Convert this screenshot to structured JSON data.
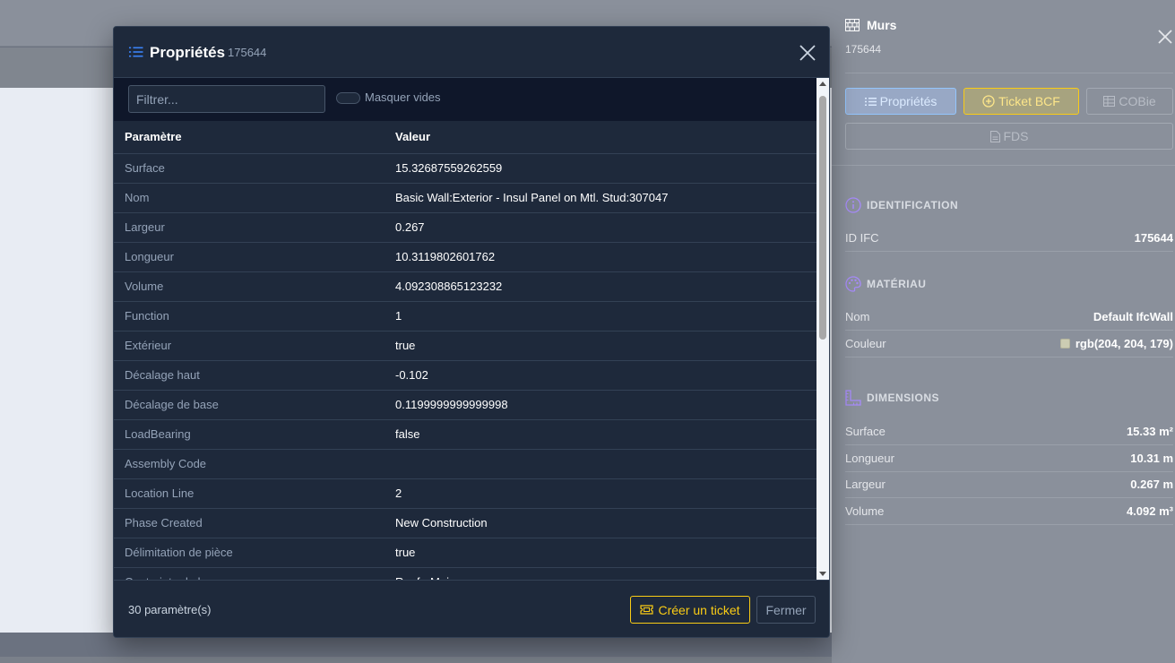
{
  "modal": {
    "title": "Propriétés",
    "element_id": "175644",
    "filter_placeholder": "Filtrer...",
    "hide_empty_label": "Masquer vides",
    "columns": [
      "Paramètre",
      "Valeur"
    ],
    "rows": [
      {
        "param": "Surface",
        "value": "15.32687559262559"
      },
      {
        "param": "Nom",
        "value": "Basic Wall:Exterior - Insul Panel on Mtl. Stud:307047"
      },
      {
        "param": "Largeur",
        "value": "0.267"
      },
      {
        "param": "Longueur",
        "value": "10.3119802601762"
      },
      {
        "param": "Volume",
        "value": "4.092308865123232"
      },
      {
        "param": "Function",
        "value": "1"
      },
      {
        "param": "Extérieur",
        "value": "true"
      },
      {
        "param": "Décalage haut",
        "value": "-0.102"
      },
      {
        "param": "Décalage de base",
        "value": "0.1199999999999998"
      },
      {
        "param": "LoadBearing",
        "value": "false"
      },
      {
        "param": "Assembly Code",
        "value": ""
      },
      {
        "param": "Location Line",
        "value": "2"
      },
      {
        "param": "Phase Created",
        "value": "New Construction"
      },
      {
        "param": "Délimitation de pièce",
        "value": "true"
      },
      {
        "param": "Contrainte de base",
        "value": "Roof - Main"
      }
    ],
    "count_label": "30 paramètre(s)",
    "create_ticket_label": "Créer un ticket",
    "close_label": "Fermer"
  },
  "side": {
    "title": "Murs",
    "element_id": "175644",
    "buttons": {
      "properties": "Propriétés",
      "ticket_bcf": "Ticket BCF",
      "cobie": "COBie",
      "fds": "FDS"
    },
    "identification": {
      "heading": "IDENTIFICATION",
      "id_label": "ID IFC",
      "id_value": "175644"
    },
    "material": {
      "heading": "MATÉRIAU",
      "name_label": "Nom",
      "name_value": "Default IfcWall",
      "color_label": "Couleur",
      "color_value": "rgb(204, 204, 179)",
      "swatch_color": "#ccccb3"
    },
    "dimensions": {
      "heading": "DIMENSIONS",
      "items": [
        {
          "label": "Surface",
          "value": "15.33 m²"
        },
        {
          "label": "Longueur",
          "value": "10.31 m"
        },
        {
          "label": "Largeur",
          "value": "0.267 m"
        },
        {
          "label": "Volume",
          "value": "4.092 m³"
        }
      ]
    }
  },
  "colors": {
    "accent_blue": "#3b82f6",
    "accent_yellow": "#facc15",
    "modal_bg": "#1e293b"
  }
}
